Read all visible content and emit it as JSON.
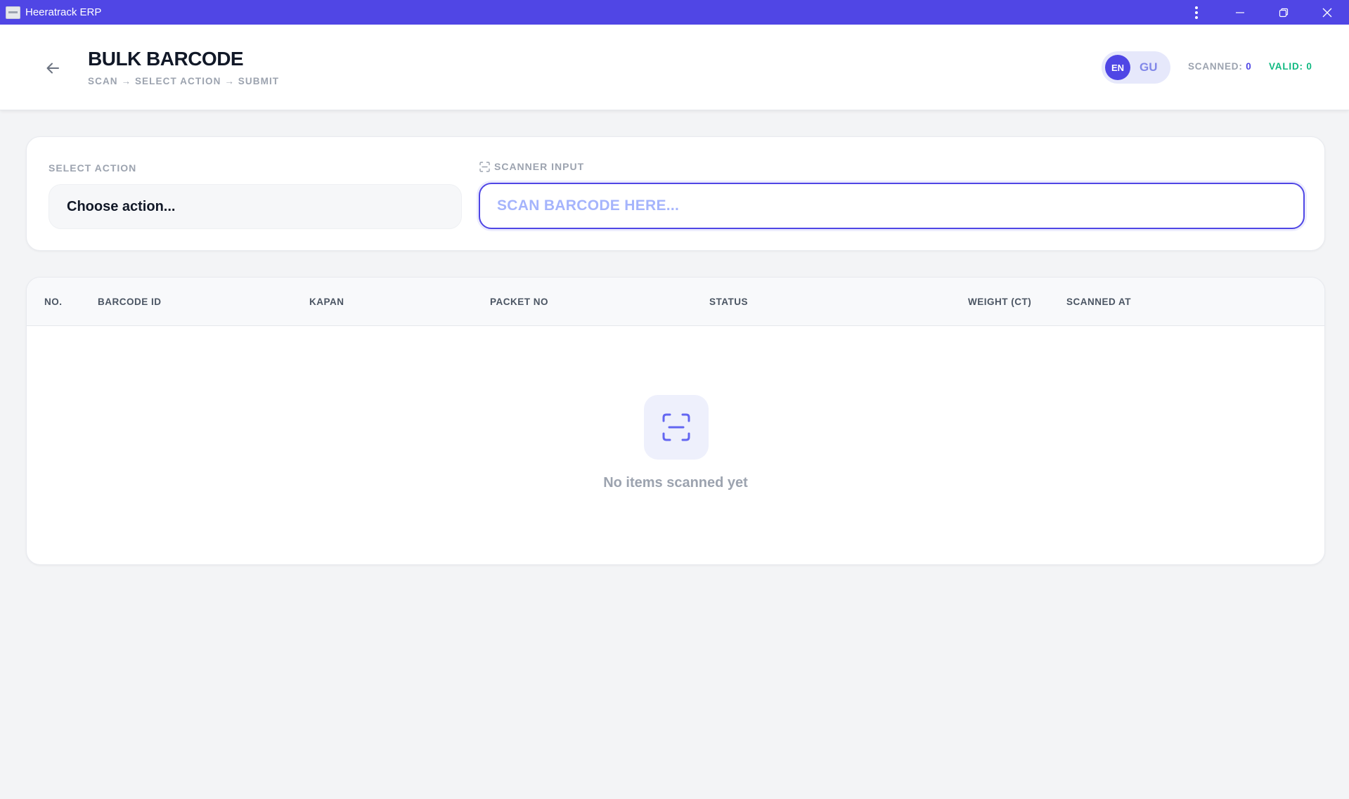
{
  "window": {
    "title": "Heeratrack ERP"
  },
  "header": {
    "title": "BULK BARCODE",
    "subtitle": "SCAN → SELECT ACTION → SUBMIT",
    "lang": {
      "active": "EN",
      "inactive": "GU"
    },
    "stats": {
      "scanned_label": "SCANNED:",
      "scanned_value": "0",
      "valid_label": "VALID:",
      "valid_value": "0"
    }
  },
  "action_panel": {
    "select_label": "SELECT ACTION",
    "select_value": "Choose action...",
    "scanner_label": "SCANNER INPUT",
    "scanner_placeholder": "SCAN BARCODE HERE...",
    "scanner_value": ""
  },
  "table": {
    "columns": [
      "NO.",
      "BARCODE ID",
      "KAPAN",
      "PACKET NO",
      "STATUS",
      "WEIGHT (CT)",
      "SCANNED AT"
    ],
    "rows": [],
    "empty_message": "No items scanned yet"
  },
  "colors": {
    "titlebar": "#5046e5",
    "accent": "#4f46e5",
    "valid": "#10b981",
    "muted": "#9ca3af"
  },
  "icons": {
    "back": "arrow-left-icon",
    "scanner": "scan-frame-icon",
    "empty": "scan-frame-icon",
    "menu": "kebab-menu-icon",
    "minimize": "minimize-icon",
    "restore": "restore-icon",
    "close": "close-icon"
  }
}
